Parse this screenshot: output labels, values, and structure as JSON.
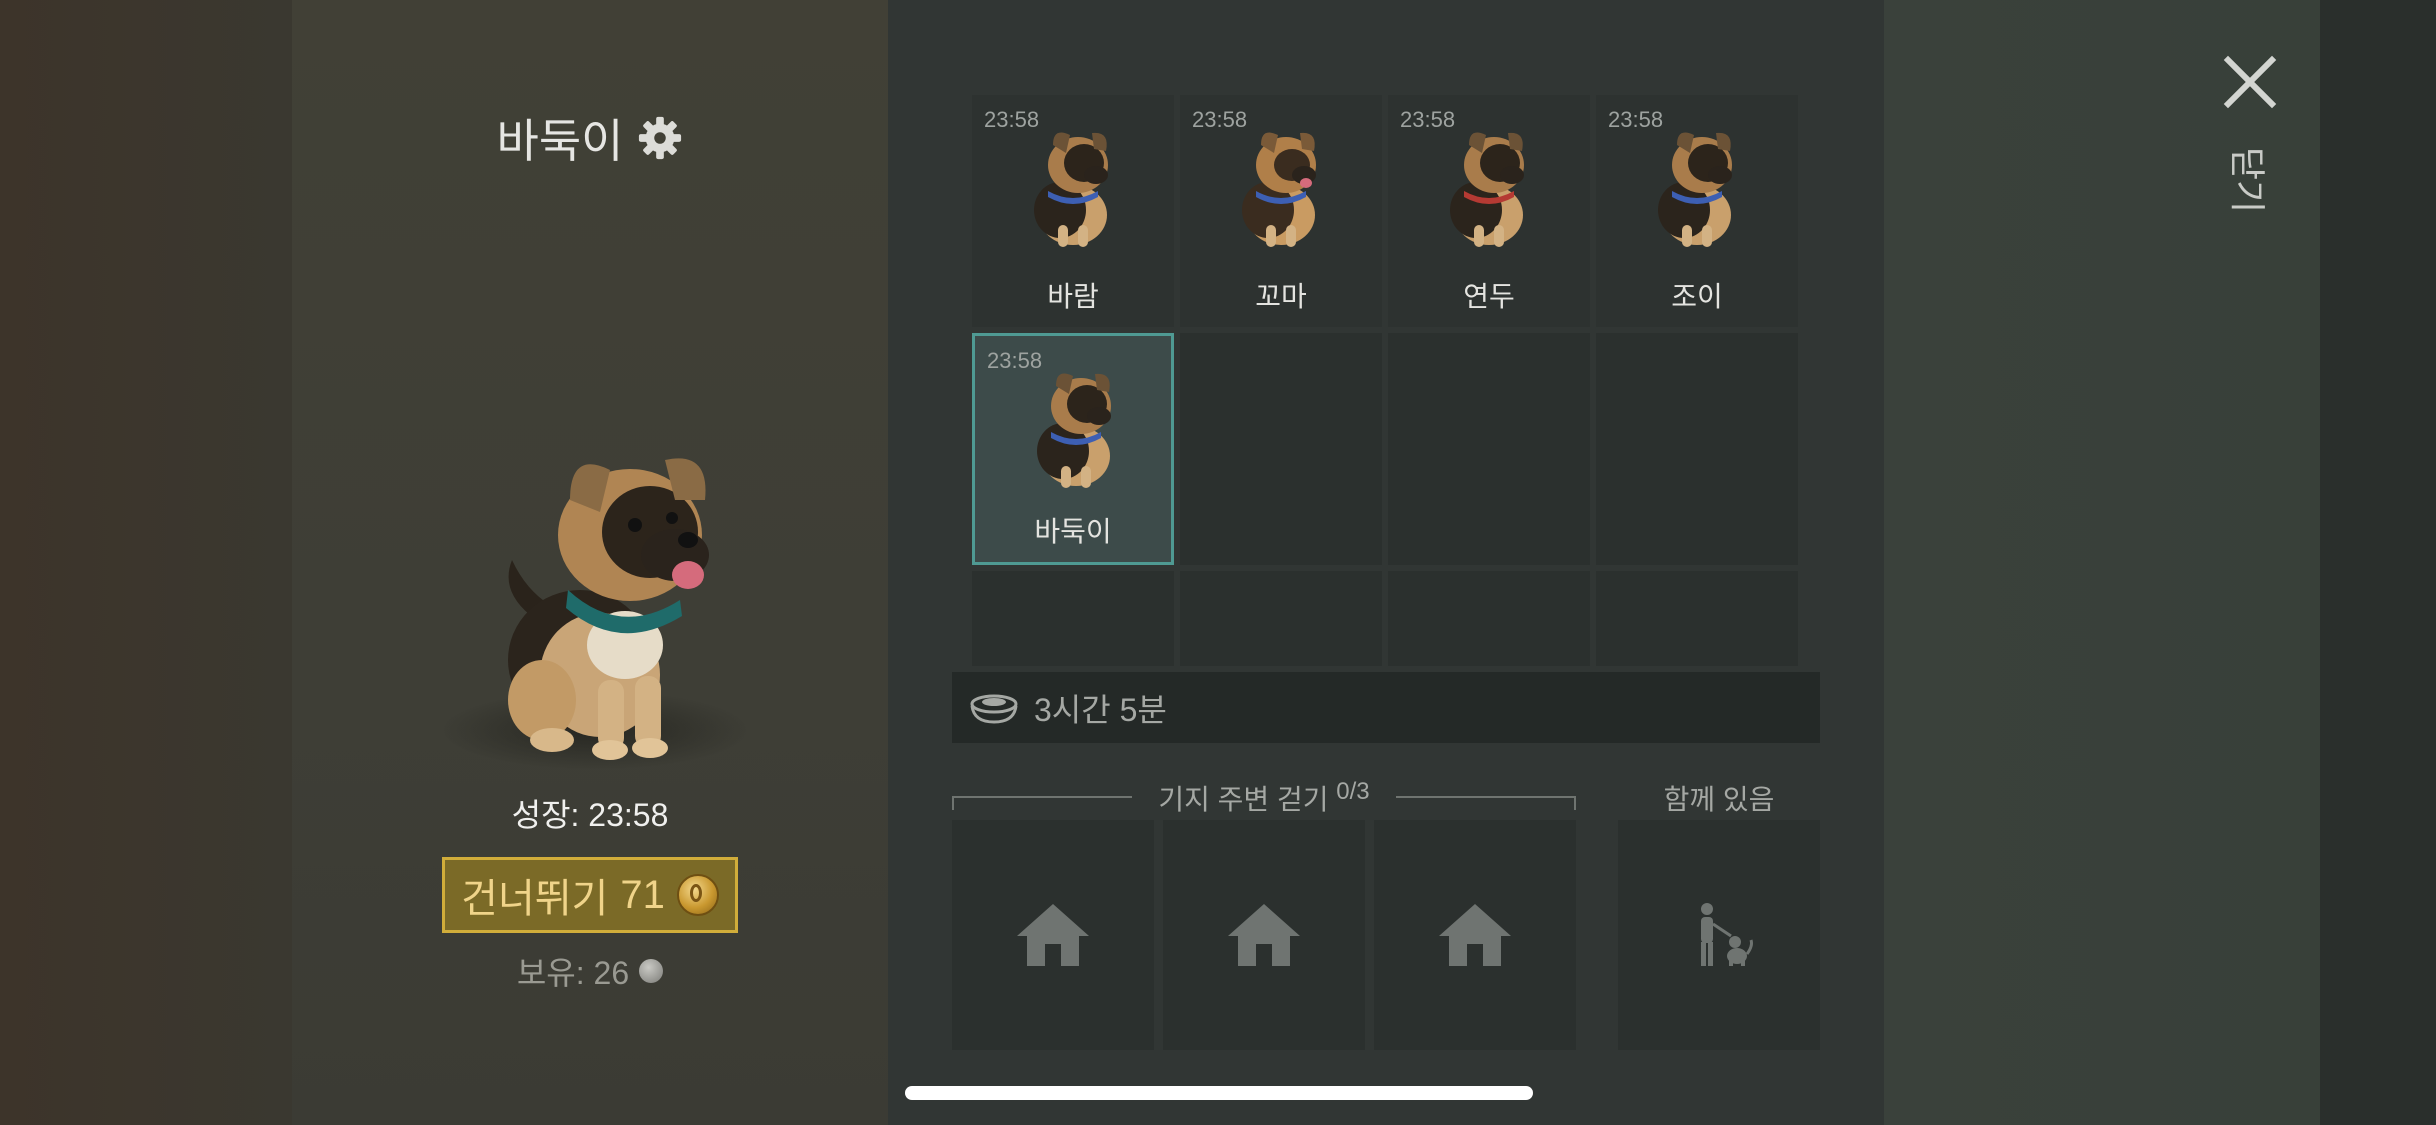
{
  "pet_detail": {
    "name": "바둑이",
    "growth_text": "성장: 23:58",
    "skip_label": "건너뛰기",
    "skip_cost": "71",
    "owned_text": "보유: 26"
  },
  "pets": [
    {
      "name": "바람",
      "timer": "23:58"
    },
    {
      "name": "꼬마",
      "timer": "23:58"
    },
    {
      "name": "연두",
      "timer": "23:58"
    },
    {
      "name": "조이",
      "timer": "23:58"
    },
    {
      "name": "바둑이",
      "timer": "23:58",
      "selected": true
    }
  ],
  "food": {
    "time_left": "3시간 5분"
  },
  "walk": {
    "label": "기지 주변 걷기",
    "count": "0/3"
  },
  "with": {
    "label": "함께 있음"
  },
  "close": {
    "label": "닫기"
  },
  "colors": {
    "accent_gold": "#d1ad3a",
    "selected_border": "#4f9a93"
  }
}
